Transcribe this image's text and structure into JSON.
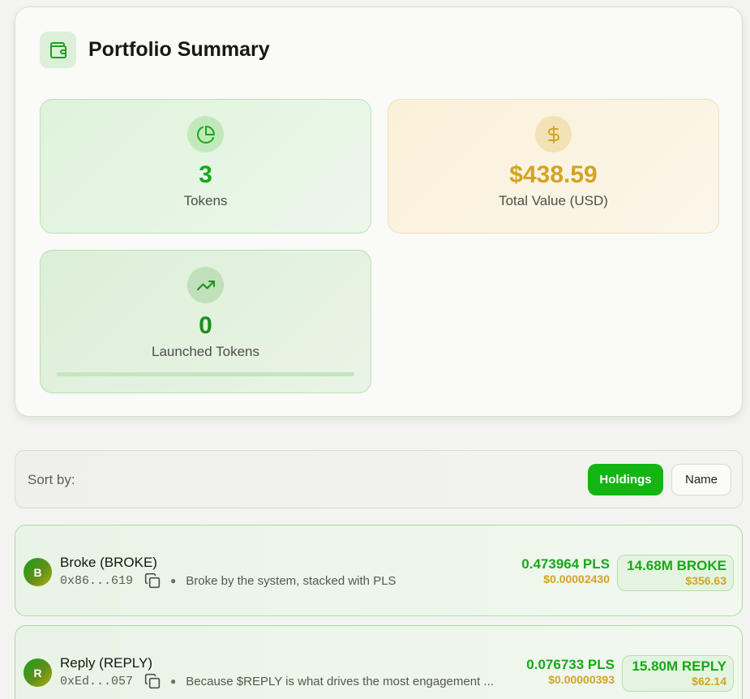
{
  "summary": {
    "title": "Portfolio Summary",
    "icon": "wallet-icon",
    "stats": {
      "tokens": {
        "value": "3",
        "label": "Tokens",
        "icon": "pie-chart-icon",
        "color": "#18a818"
      },
      "total_value": {
        "value": "$438.59",
        "label": "Total Value (USD)",
        "icon": "dollar-icon",
        "color": "#d3a422"
      },
      "launched": {
        "value": "0",
        "label": "Launched Tokens",
        "icon": "trending-up-icon",
        "color": "#1b8f1b",
        "progress": 0
      }
    }
  },
  "sort": {
    "label": "Sort by:",
    "options": [
      "Holdings",
      "Name"
    ],
    "active": "Holdings",
    "accent": "#13b513"
  },
  "tokens": [
    {
      "avatar": "B",
      "name": "Broke (BROKE)",
      "address": "0x86...619",
      "description": "Broke by the system, stacked with PLS",
      "price_pls": "0.473964 PLS",
      "price_usd": "$0.00002430",
      "holding_amount": "14.68M BROKE",
      "holding_usd": "$356.63"
    },
    {
      "avatar": "R",
      "name": "Reply (REPLY)",
      "address": "0xEd...057",
      "description": "Because $REPLY is what drives the most engagement ...",
      "price_pls": "0.076733 PLS",
      "price_usd": "$0.00000393",
      "holding_amount": "15.80M REPLY",
      "holding_usd": "$62.14"
    }
  ]
}
